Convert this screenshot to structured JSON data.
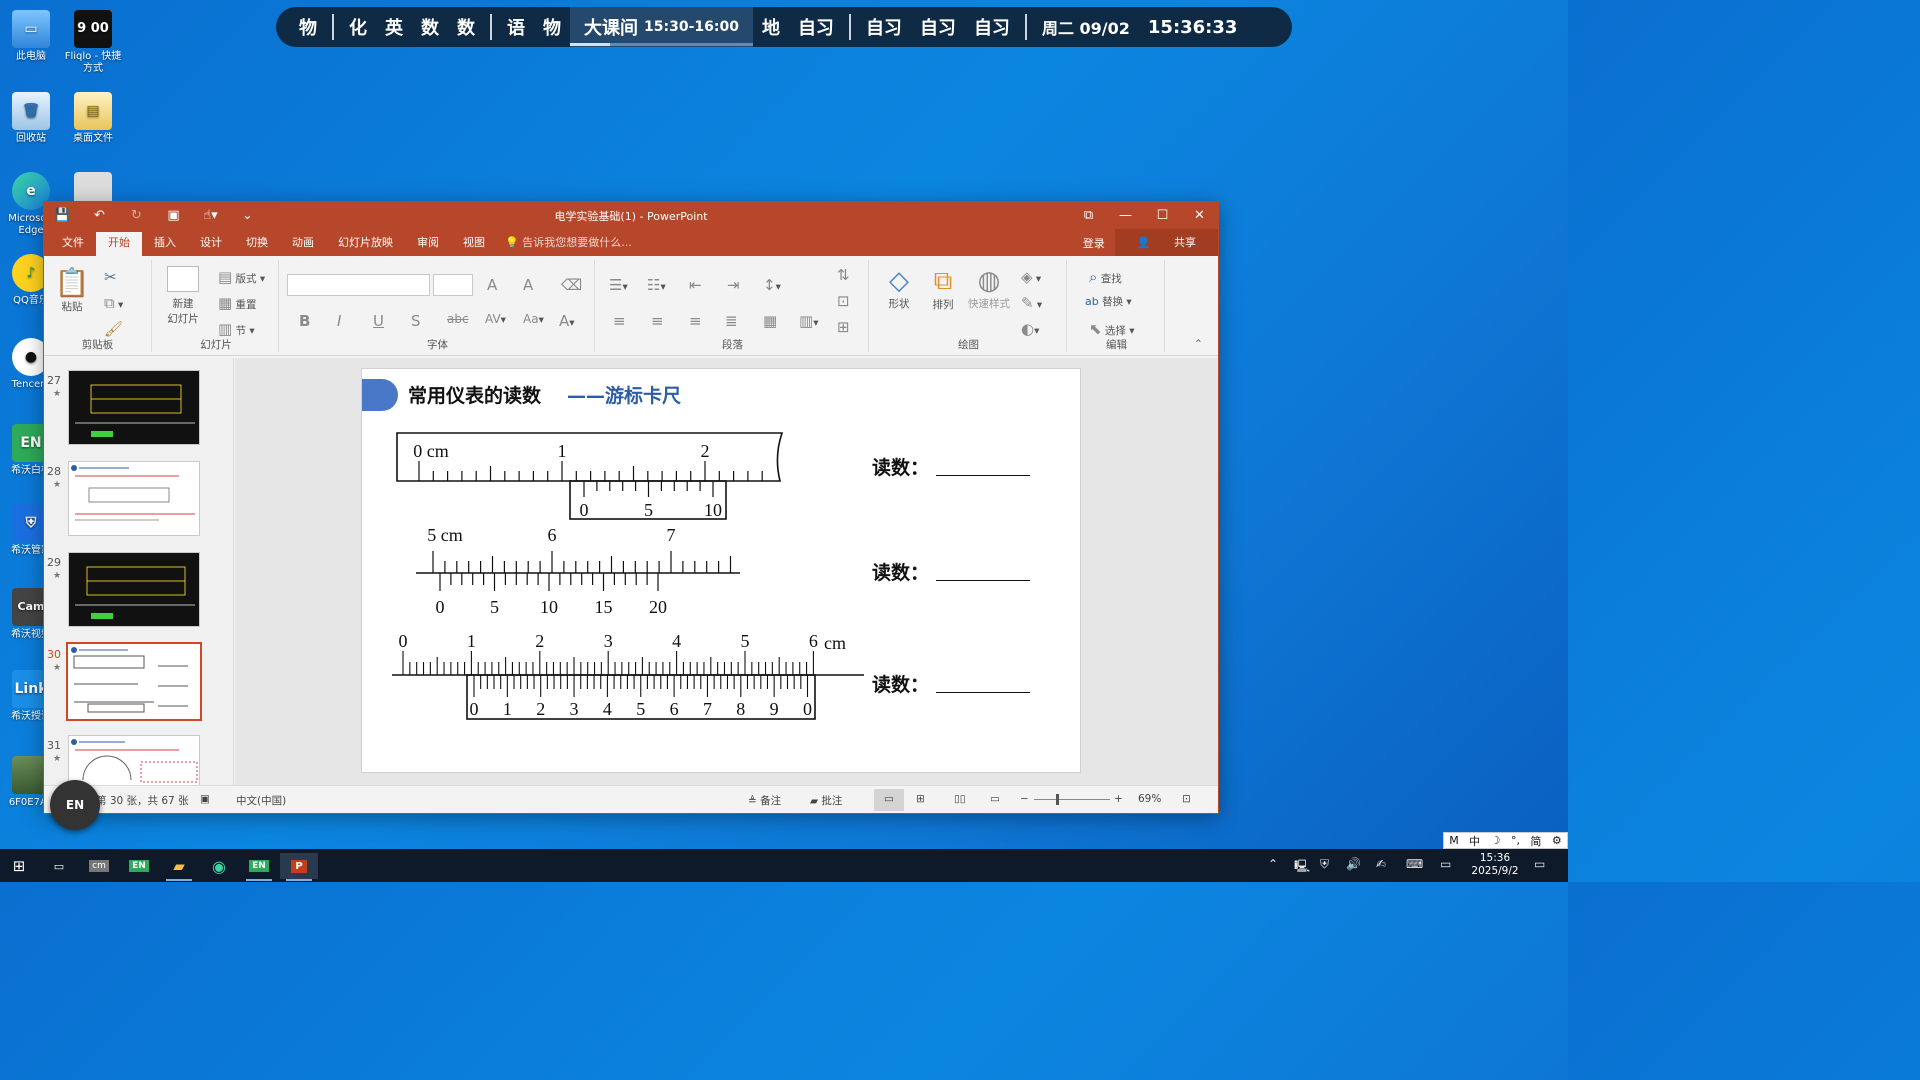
{
  "desktop": {
    "icons": [
      {
        "label": "此电脑"
      },
      {
        "label": "Fliqlo - 快捷方式",
        "clock": "9 00"
      },
      {
        "label": "回收站"
      },
      {
        "label": "桌面文件"
      },
      {
        "label": "Microsoft Edge"
      },
      {
        "label": "QQ音乐"
      },
      {
        "label": "Tencent"
      },
      {
        "label": "希沃白板"
      },
      {
        "label": "希沃管家"
      },
      {
        "label": "希沃视频"
      },
      {
        "label": "希沃授课"
      },
      {
        "label": "6F0E7A4"
      }
    ]
  },
  "schedule": {
    "items": [
      "物",
      "化",
      "英",
      "数",
      "数",
      "语",
      "物",
      "地",
      "自习",
      "自习",
      "自习",
      "自习"
    ],
    "current": {
      "label": "大课间",
      "time": "15:30-16:00",
      "progress": 0.22
    },
    "date": "周二 09/02",
    "time": "15:36:33"
  },
  "window": {
    "title": "电学实验基础(1) - PowerPoint",
    "tabs": [
      "文件",
      "开始",
      "插入",
      "设计",
      "切换",
      "动画",
      "幻灯片放映",
      "审阅",
      "视图"
    ],
    "active_tab": "开始",
    "tell_me": "告诉我您想要做什么...",
    "login": "登录",
    "share": "共享"
  },
  "ribbon": {
    "clipboard": {
      "paste": "粘贴",
      "label": "剪贴板"
    },
    "slides": {
      "new": "新建",
      "new2": "幻灯片",
      "layout": "版式",
      "reset": "重置",
      "section": "节",
      "label": "幻灯片"
    },
    "font": {
      "label": "字体"
    },
    "paragraph": {
      "label": "段落"
    },
    "drawing": {
      "shape": "形状",
      "arrange": "排列",
      "quickstyle": "快速样式",
      "label": "绘图"
    },
    "editing": {
      "find": "查找",
      "replace": "替换",
      "select": "选择",
      "label": "编辑"
    }
  },
  "thumbnails": [
    {
      "num": "27",
      "star": "★"
    },
    {
      "num": "28",
      "star": "★"
    },
    {
      "num": "29",
      "star": "★"
    },
    {
      "num": "30",
      "star": "★"
    },
    {
      "num": "31",
      "star": "★"
    }
  ],
  "slide": {
    "title": "常用仪表的读数",
    "subtitle": "——游标卡尺",
    "reading_label": "读数：",
    "caliper1": {
      "main": [
        "0 cm",
        "1",
        "2"
      ],
      "vernier": [
        "0",
        "5",
        "10"
      ]
    },
    "caliper2": {
      "main": [
        "5 cm",
        "6",
        "7"
      ],
      "vernier": [
        "0",
        "5",
        "10",
        "15",
        "20"
      ]
    },
    "caliper3": {
      "main": [
        "0",
        "1",
        "2",
        "3",
        "4",
        "5",
        "6",
        "cm"
      ],
      "vernier": [
        "0",
        "1",
        "2",
        "3",
        "4",
        "5",
        "6",
        "7",
        "8",
        "9",
        "0"
      ]
    }
  },
  "status": {
    "slide_info": "第 30 张，共 67 张",
    "language": "中文(中国)",
    "notes": "备注",
    "comments": "批注",
    "zoom": "69%"
  },
  "en_ball": "EN",
  "ime": [
    "M",
    "中",
    "简"
  ],
  "taskbar": {
    "time": "15:36",
    "date": "2025/9/2"
  }
}
